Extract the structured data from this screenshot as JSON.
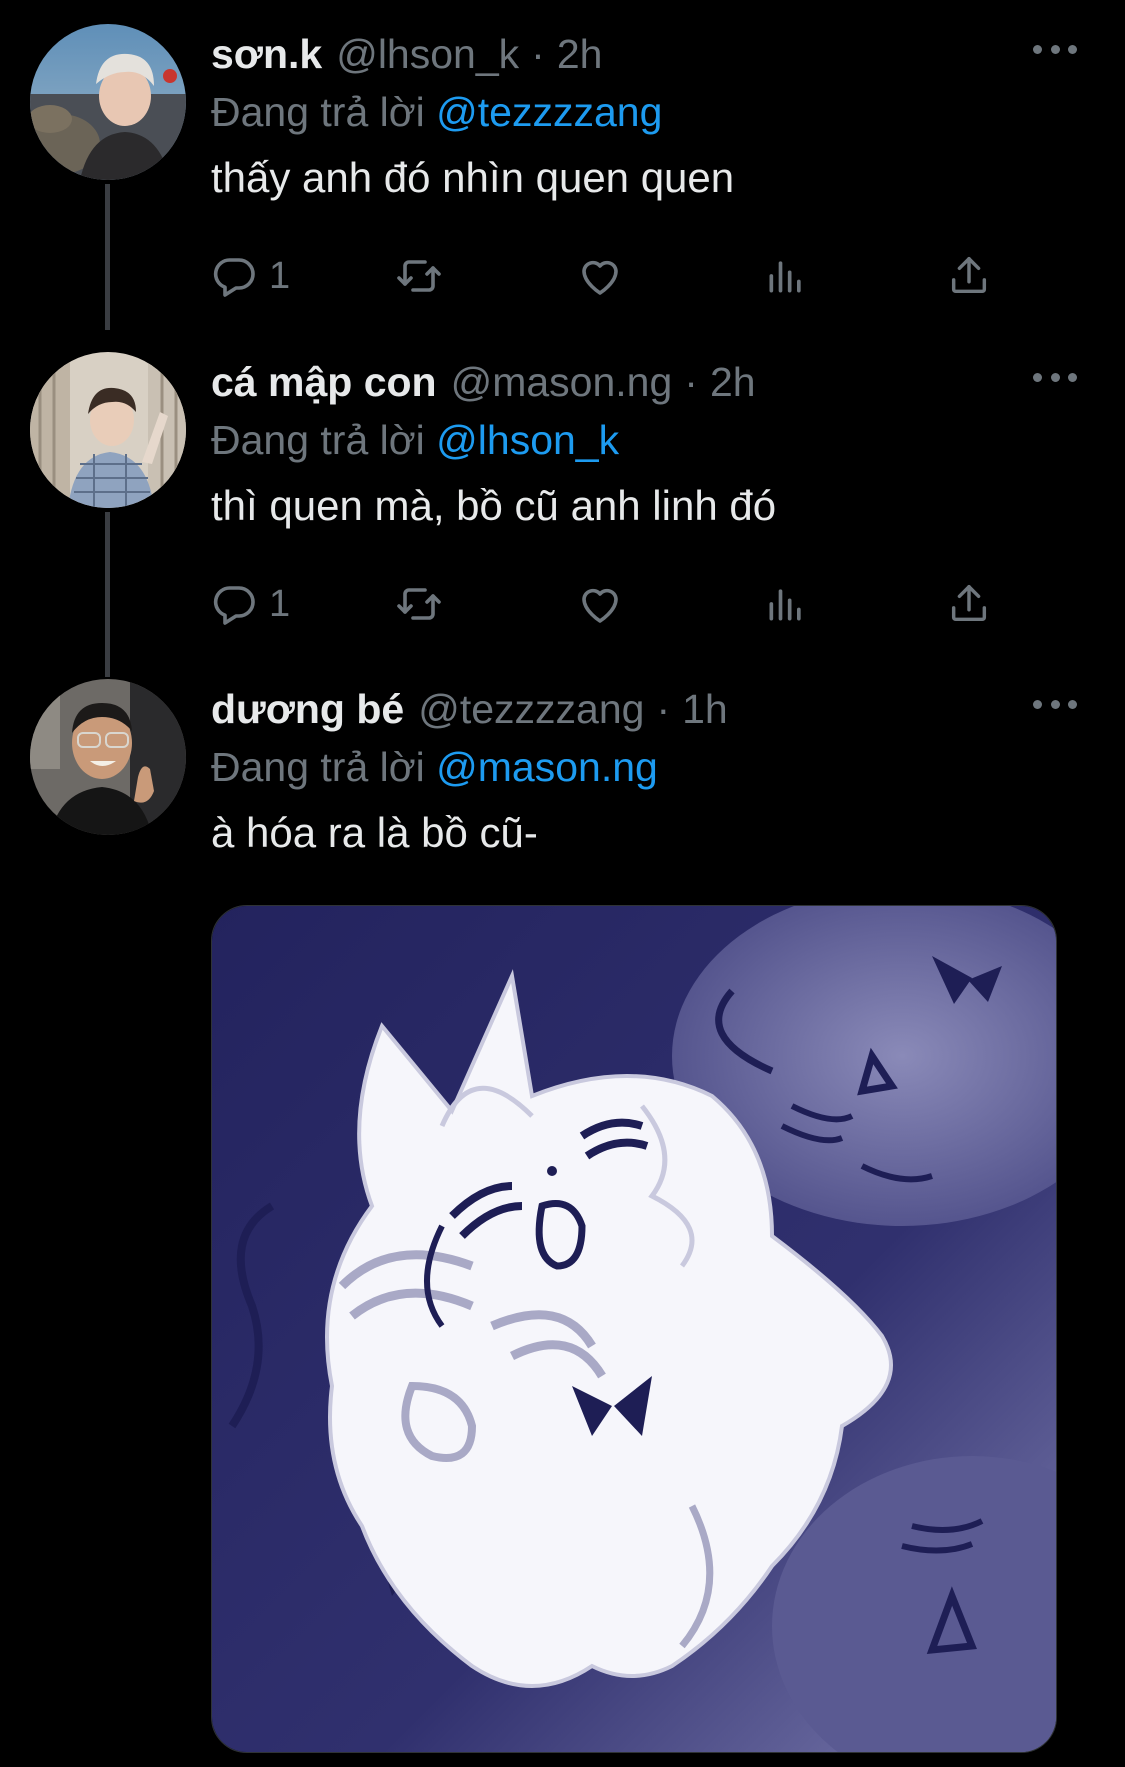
{
  "colors": {
    "background": "#000000",
    "text": "#e7e9ea",
    "muted": "#6e767d",
    "mention": "#1d9bf0",
    "thread_line": "#3a3d42"
  },
  "tweets": [
    {
      "display_name": "sơn.k",
      "handle": "@lhson_k",
      "separator": "·",
      "time": "2h",
      "reply_prefix": "Đang trả lời",
      "reply_mention": "@tezzzzang",
      "text": "thấy anh đó nhìn quen quen",
      "reply_count": "1",
      "avatar_icon": "avatar-photo",
      "more_icon": "more-horizontal-icon"
    },
    {
      "display_name": "cá mập con",
      "handle": "@mason.ng",
      "separator": "·",
      "time": "2h",
      "reply_prefix": "Đang trả lời",
      "reply_mention": "@lhson_k",
      "text": "thì quen mà, bồ cũ anh linh đó",
      "reply_count": "1",
      "avatar_icon": "avatar-photo",
      "more_icon": "more-horizontal-icon"
    },
    {
      "display_name": "dương bé",
      "handle": "@tezzzzang",
      "separator": "·",
      "time": "1h",
      "reply_prefix": "Đang trả lời",
      "reply_mention": "@mason.ng",
      "text": "à hóa ra là bồ cũ-",
      "avatar_icon": "avatar-photo",
      "more_icon": "more-horizontal-icon",
      "media_icon": "cartoon-cat-crying-image"
    }
  ],
  "action_icons": [
    "reply-icon",
    "retweet-icon",
    "like-icon",
    "analytics-icon",
    "share-icon"
  ]
}
